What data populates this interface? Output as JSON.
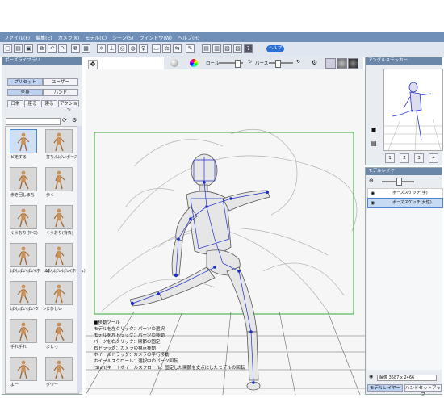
{
  "menu": [
    "ファイル(F)",
    "編集(E)",
    "カメラ(K)",
    "モデル(C)",
    "シーン(S)",
    "ウィンドウ(W)",
    "ヘルプ(H)"
  ],
  "toolbar": {
    "badge_label": "ヘルプ"
  },
  "view_controls": {
    "roll_label": "ロール",
    "perspective_label": "パース"
  },
  "pose_library": {
    "title": "ポーズライブラリ",
    "tabs": [
      "プリセット",
      "ユーザー"
    ],
    "subtabs": [
      "全身",
      "ハンド"
    ],
    "categories": [
      "日常",
      "座る",
      "寝る",
      "アクション"
    ],
    "thumbnails": [
      {
        "label": "ピ走する"
      },
      {
        "label": "打ちんばいポーズ"
      },
      {
        "label": "歩き回しまち"
      },
      {
        "label": "歩く"
      },
      {
        "label": "くうおり(持つ)"
      },
      {
        "label": "くうおり(背負)"
      },
      {
        "label": "ばんばいばい(ホーム)"
      },
      {
        "label": "ばんばいばい(ホーム)"
      },
      {
        "label": "ばんばいばいウーン"
      },
      {
        "label": "まひしい"
      },
      {
        "label": "手れ手れ"
      },
      {
        "label": "よしっ"
      },
      {
        "label": "よー"
      },
      {
        "label": "ダウー"
      }
    ]
  },
  "hint": {
    "lines": [
      "■移動ツール",
      "モデルを左クリック：パーツの選択",
      "モデルを左ドラッグ：パーツの移動",
      "パーツを右クリック：関節の固定",
      "右ドラッグ：カメラの視点移動",
      "ホイールドラッグ：カメラの平行移動",
      "ホイールスクロール：選択中のパーツ回転",
      "[Shift]キー＋ホイールスクロール：固定した関節を支点にしたモデルの回転"
    ]
  },
  "angle_sticker": {
    "title": "アングルステッカー",
    "buttons": [
      "1",
      "2",
      "3",
      "4"
    ]
  },
  "model_layer": {
    "title": "モデルレイヤー",
    "layers": [
      {
        "name": "ポーズスケッチ(手)"
      },
      {
        "name": "ポーズスケッチ(女性)"
      }
    ],
    "size_readout": "解像 3587 x 2466",
    "tabs": [
      "モデルレイヤー",
      "ハンドセットアップ"
    ]
  },
  "colors": {
    "menubar": "#6f8fb8",
    "frame": "#3aa63a",
    "rig": "#2233cc",
    "accent": "#4a84d0"
  }
}
